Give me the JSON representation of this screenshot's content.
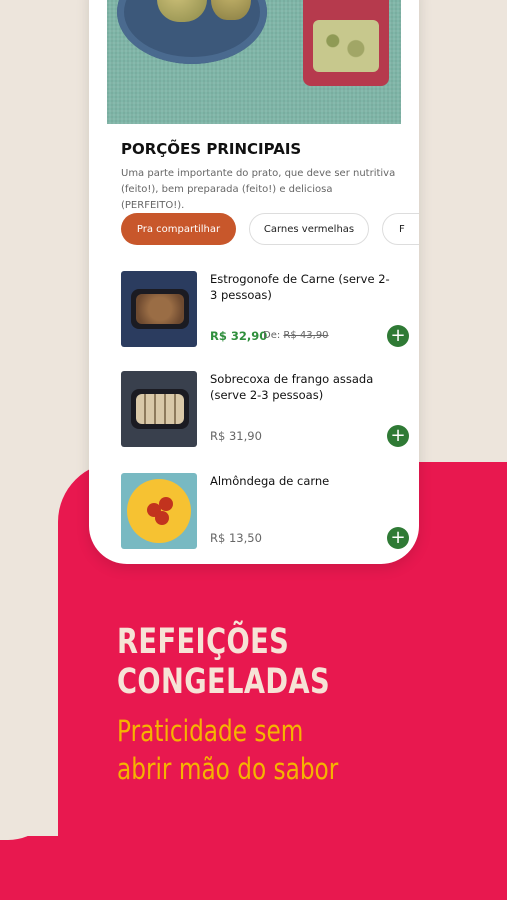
{
  "section": {
    "title": "PORÇÕES PRINCIPAIS",
    "description": "Uma parte importante do prato, que deve ser nutritiva (feito!), bem preparada (feito!) e deliciosa (PERFEITO!)."
  },
  "chips": [
    {
      "label": "Pra compartilhar",
      "active": true
    },
    {
      "label": "Carnes vermelhas",
      "active": false
    },
    {
      "label": "F",
      "active": false
    }
  ],
  "products": [
    {
      "name": "Estrogonofe de Carne (serve 2-3 pessoas)",
      "price": "R$ 32,90",
      "old_prefix": "De:",
      "old_price": "R$ 43,90"
    },
    {
      "name": "Sobrecoxa de frango assada (serve 2-3 pessoas)",
      "price": "R$ 31,90"
    },
    {
      "name": "Almôndega de carne",
      "price": "R$ 13,50"
    }
  ],
  "add_button_symbol": "+",
  "promo": {
    "headline_line1": "REFEIÇÕES",
    "headline_line2": "CONGELADAS",
    "subline_line1": "Praticidade sem",
    "subline_line2": "abrir mão do sabor"
  },
  "colors": {
    "background": "#ede5dc",
    "promo_pink": "#e8184f",
    "chip_active": "#c8572b",
    "price_green": "#2f8f3c",
    "add_button": "#2f7a35",
    "subline_yellow": "#f5b400"
  }
}
